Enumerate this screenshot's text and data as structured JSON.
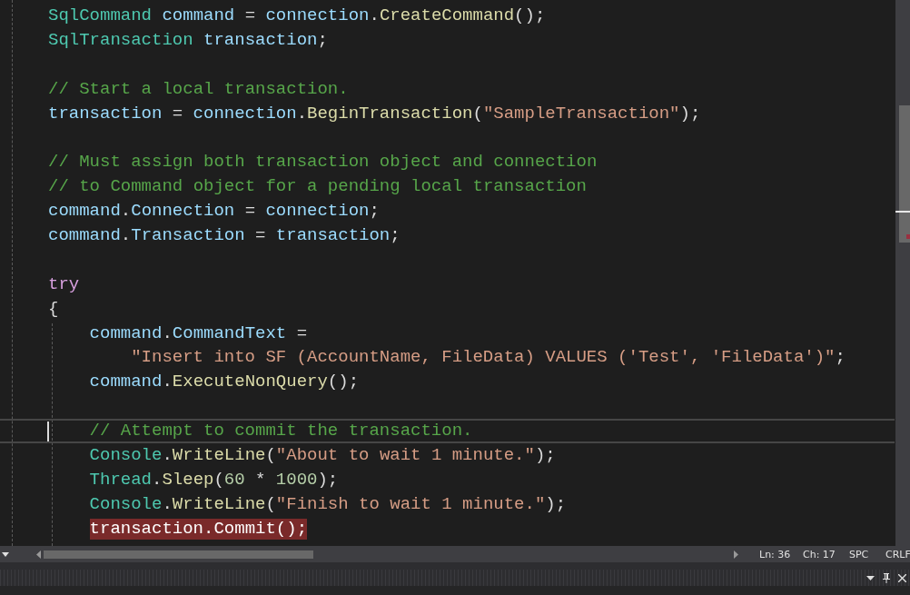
{
  "code_lines": [
    {
      "kind": "code",
      "current": false,
      "breakpoint": false,
      "tokens": [
        {
          "kind": "type",
          "text": "SqlCommand"
        },
        {
          "kind": "var",
          "text": "command"
        },
        {
          "kind": "plain",
          "text": "="
        },
        {
          "kind": "var",
          "text": "connection"
        },
        {
          "kind": "plain",
          "text": "."
        },
        {
          "kind": "method",
          "text": "CreateCommand"
        },
        {
          "kind": "plain",
          "text": "();"
        }
      ]
    },
    {
      "kind": "code",
      "current": false,
      "breakpoint": false,
      "tokens": [
        {
          "kind": "type",
          "text": "SqlTransaction"
        },
        {
          "kind": "var",
          "text": "transaction"
        },
        {
          "kind": "plain",
          "text": ";"
        }
      ]
    },
    {
      "kind": "blank"
    },
    {
      "kind": "code",
      "current": false,
      "breakpoint": false,
      "tokens": [
        {
          "kind": "comment",
          "text": "// Start a local transaction."
        }
      ]
    },
    {
      "kind": "code",
      "current": false,
      "breakpoint": false,
      "tokens": [
        {
          "kind": "var",
          "text": "transaction"
        },
        {
          "kind": "plain",
          "text": "="
        },
        {
          "kind": "var",
          "text": "connection"
        },
        {
          "kind": "plain",
          "text": "."
        },
        {
          "kind": "method",
          "text": "BeginTransaction"
        },
        {
          "kind": "plain",
          "text": "("
        },
        {
          "kind": "string",
          "text": "\"SampleTransaction\""
        },
        {
          "kind": "plain",
          "text": ");"
        }
      ]
    },
    {
      "kind": "blank"
    },
    {
      "kind": "code",
      "current": false,
      "breakpoint": false,
      "tokens": [
        {
          "kind": "comment",
          "text": "// Must assign both transaction object and connection"
        }
      ]
    },
    {
      "kind": "code",
      "current": false,
      "breakpoint": false,
      "tokens": [
        {
          "kind": "comment",
          "text": "// to Command object for a pending local transaction"
        }
      ]
    },
    {
      "kind": "code",
      "current": false,
      "breakpoint": false,
      "tokens": [
        {
          "kind": "var",
          "text": "command"
        },
        {
          "kind": "plain",
          "text": "."
        },
        {
          "kind": "var",
          "text": "Connection"
        },
        {
          "kind": "plain",
          "text": "="
        },
        {
          "kind": "var",
          "text": "connection"
        },
        {
          "kind": "plain",
          "text": ";"
        }
      ]
    },
    {
      "kind": "code",
      "current": false,
      "breakpoint": false,
      "tokens": [
        {
          "kind": "var",
          "text": "command"
        },
        {
          "kind": "plain",
          "text": "."
        },
        {
          "kind": "var",
          "text": "Transaction"
        },
        {
          "kind": "plain",
          "text": "="
        },
        {
          "kind": "var",
          "text": "transaction"
        },
        {
          "kind": "plain",
          "text": ";"
        }
      ]
    },
    {
      "kind": "blank"
    },
    {
      "kind": "code",
      "current": false,
      "breakpoint": false,
      "tokens": [
        {
          "kind": "keyword",
          "text": "try"
        }
      ]
    },
    {
      "kind": "code",
      "current": false,
      "breakpoint": false,
      "tokens": [
        {
          "kind": "plain",
          "text": "{"
        }
      ],
      "children": [
        {
          "kind": "code",
          "current": false,
          "breakpoint": false,
          "tokens": [
            {
              "kind": "var",
              "text": "command"
            },
            {
              "kind": "plain",
              "text": "."
            },
            {
              "kind": "var",
              "text": "CommandText"
            },
            {
              "kind": "plain",
              "text": "="
            }
          ],
          "children": [
            {
              "kind": "code",
              "current": false,
              "breakpoint": false,
              "tokens": [
                {
                  "kind": "string",
                  "text": "\"Insert into SF (AccountName, FileData) VALUES ('Test', 'FileData')\""
                },
                {
                  "kind": "plain",
                  "text": ";"
                }
              ]
            }
          ]
        },
        {
          "kind": "code",
          "current": false,
          "breakpoint": false,
          "tokens": [
            {
              "kind": "var",
              "text": "command"
            },
            {
              "kind": "plain",
              "text": "."
            },
            {
              "kind": "method",
              "text": "ExecuteNonQuery"
            },
            {
              "kind": "plain",
              "text": "();"
            }
          ]
        },
        {
          "kind": "blank"
        },
        {
          "kind": "code",
          "current": true,
          "breakpoint": false,
          "tokens": [
            {
              "kind": "comment",
              "text": "// Attempt to commit the transaction."
            }
          ]
        },
        {
          "kind": "code",
          "current": false,
          "breakpoint": false,
          "tokens": [
            {
              "kind": "type",
              "text": "Console"
            },
            {
              "kind": "plain",
              "text": "."
            },
            {
              "kind": "method",
              "text": "WriteLine"
            },
            {
              "kind": "plain",
              "text": "("
            },
            {
              "kind": "string",
              "text": "\"About to wait 1 minute.\""
            },
            {
              "kind": "plain",
              "text": ");"
            }
          ]
        },
        {
          "kind": "code",
          "current": false,
          "breakpoint": false,
          "tokens": [
            {
              "kind": "type",
              "text": "Thread"
            },
            {
              "kind": "plain",
              "text": "."
            },
            {
              "kind": "method",
              "text": "Sleep"
            },
            {
              "kind": "plain",
              "text": "("
            },
            {
              "kind": "number",
              "text": "60"
            },
            {
              "kind": "plain",
              "text": "*"
            },
            {
              "kind": "number",
              "text": "1000"
            },
            {
              "kind": "plain",
              "text": ");"
            }
          ]
        },
        {
          "kind": "code",
          "current": false,
          "breakpoint": false,
          "tokens": [
            {
              "kind": "type",
              "text": "Console"
            },
            {
              "kind": "plain",
              "text": "."
            },
            {
              "kind": "method",
              "text": "WriteLine"
            },
            {
              "kind": "plain",
              "text": "("
            },
            {
              "kind": "string",
              "text": "\"Finish to wait 1 minute.\""
            },
            {
              "kind": "plain",
              "text": ");"
            }
          ]
        },
        {
          "kind": "code",
          "current": false,
          "breakpoint": true,
          "tokens": [
            {
              "kind": "var",
              "text": "transaction"
            },
            {
              "kind": "plain",
              "text": "."
            },
            {
              "kind": "method",
              "text": "Commit"
            },
            {
              "kind": "plain",
              "text": "();"
            }
          ]
        }
      ]
    }
  ],
  "status_bar": {
    "line": "Ln: 36",
    "column": "Ch: 17",
    "whitespace": "SPC",
    "line_ending": "CRLF"
  }
}
